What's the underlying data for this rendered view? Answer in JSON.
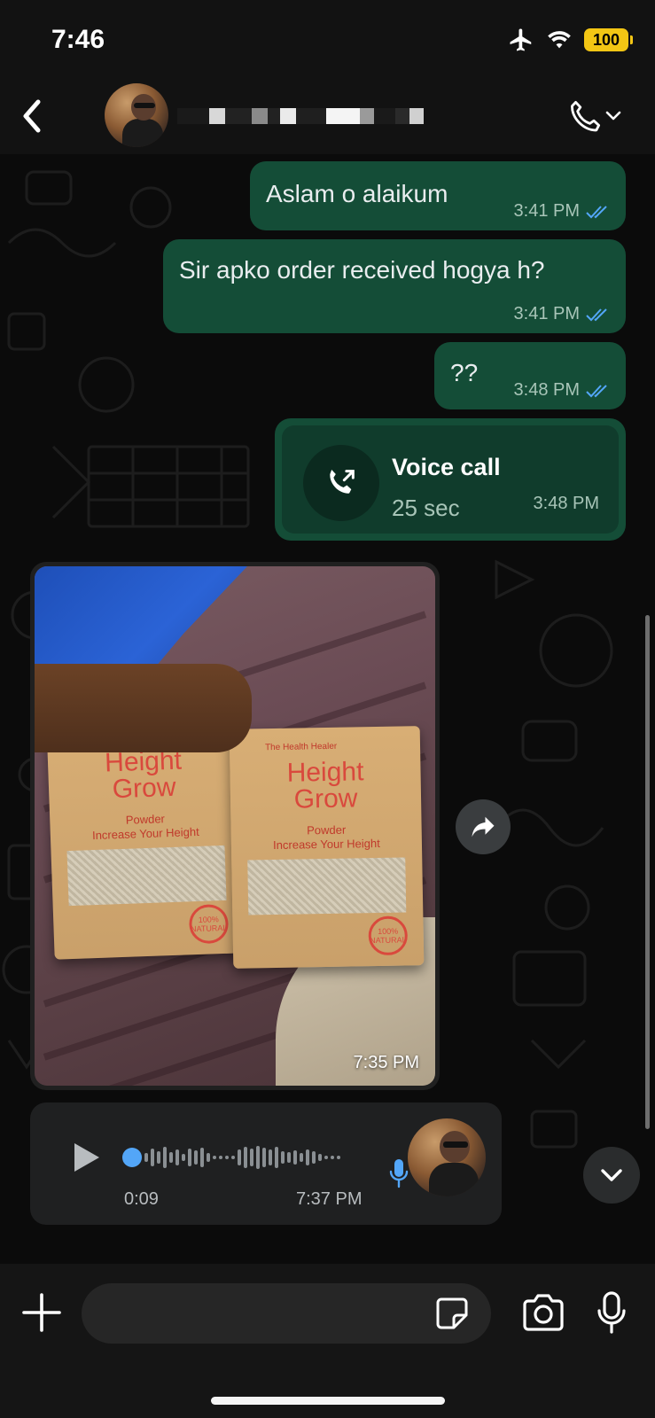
{
  "status_bar": {
    "time": "7:46",
    "battery": "100"
  },
  "header": {
    "contact_name": "",
    "icons": [
      "back-chevron-icon",
      "phone-icon",
      "chevron-down-icon"
    ]
  },
  "messages": [
    {
      "type": "text",
      "direction": "outgoing",
      "text": "Aslam o alaikum",
      "time": "3:41 PM",
      "status": "read"
    },
    {
      "type": "text",
      "direction": "outgoing",
      "text": "Sir apko order received hogya h?",
      "time": "3:41 PM",
      "status": "read"
    },
    {
      "type": "text",
      "direction": "outgoing",
      "text": "??",
      "time": "3:48 PM",
      "status": "read"
    },
    {
      "type": "call",
      "direction": "outgoing",
      "title": "Voice call",
      "duration": "25 sec",
      "time": "3:48 PM"
    },
    {
      "type": "image",
      "direction": "incoming",
      "time": "7:35 PM",
      "product": {
        "brand": "The Health Healer",
        "name_line1": "Height",
        "name_line2": "Grow",
        "subtitle": "Powder",
        "tagline": "Increase Your Height",
        "seal": "100% NATURAL"
      }
    },
    {
      "type": "audio",
      "direction": "incoming",
      "duration": "0:09",
      "time": "7:37 PM",
      "progress": 0
    }
  ],
  "input": {
    "placeholder": "",
    "value": ""
  },
  "colors": {
    "outgoing_bubble": "#144d37",
    "read_ticks": "#53a6f8",
    "background": "#0b0b0b"
  }
}
